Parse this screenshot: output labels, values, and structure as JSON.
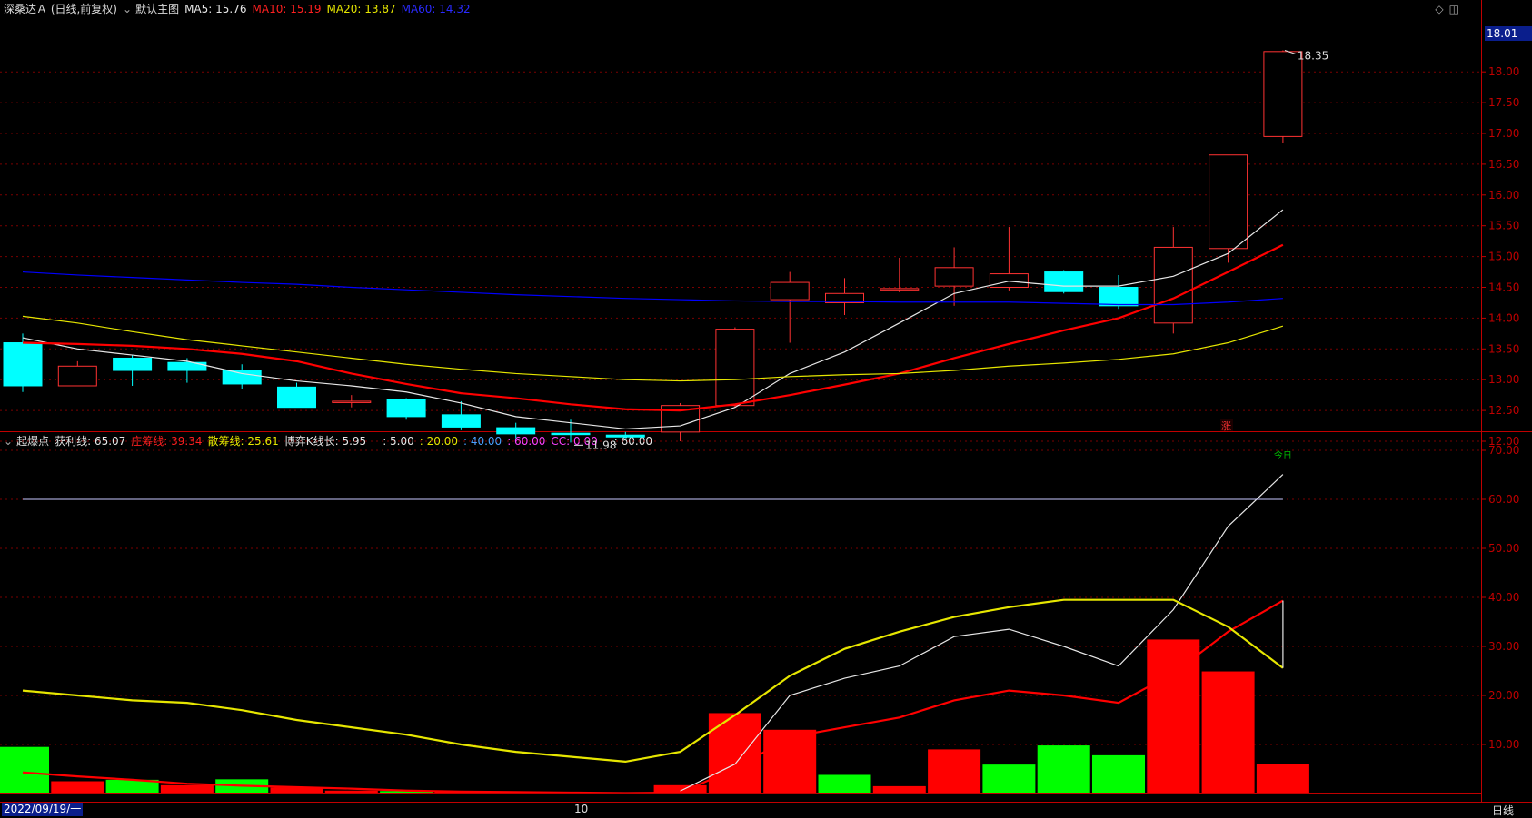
{
  "main_header": {
    "stock": "深桑达Ａ (日线,前复权)",
    "template": "默认主图",
    "ma5": "MA5: 15.76",
    "ma10": "MA10: 15.19",
    "ma20": "MA20: 13.87",
    "ma60": "MA60: 14.32"
  },
  "sub_header": {
    "name": "起爆点",
    "huoli": "获利线: 65.07",
    "zhuang": "庄筹线: 39.34",
    "san": "散筹线: 25.61",
    "boyi": "博弈K线长: 5.95",
    "v1": ": 5.00",
    "v2": ": 20.00",
    "v3": ": 40.00",
    "v4": ": 60.00",
    "cc": "CC: 0.00",
    "v5": ": 60.00"
  },
  "colors": {
    "up": "#ff3232",
    "down": "#00ffff",
    "ma5": "#e6e6e6",
    "ma10": "#ff0000",
    "ma20": "#e6e600",
    "ma60": "#0000ff",
    "grid": "#7a0000",
    "bar_red": "#ff0000",
    "bar_green": "#00ff00"
  },
  "price_tag": "18.01",
  "max_label": "18.35",
  "min_label": "11.98",
  "zhang_marker": "涨",
  "signal_label": "今日",
  "date_left": "2022/09/19/一",
  "date_mid": "10",
  "period_label": "日线",
  "window_icons": [
    "diamond-icon",
    "restore-icon"
  ],
  "chart_data": [
    {
      "type": "candlestick",
      "title": "深桑达Ａ (日线,前复权)",
      "ylim": [
        11.85,
        18.15
      ],
      "yticks": [
        12.0,
        12.5,
        13.0,
        13.5,
        14.0,
        14.5,
        15.0,
        15.5,
        16.0,
        16.5,
        17.0,
        17.5,
        18.0
      ],
      "candles": [
        {
          "o": 13.6,
          "h": 13.75,
          "l": 12.8,
          "c": 12.9
        },
        {
          "o": 12.9,
          "h": 13.3,
          "l": 12.9,
          "c": 13.22
        },
        {
          "o": 13.35,
          "h": 13.4,
          "l": 12.9,
          "c": 13.15
        },
        {
          "o": 13.28,
          "h": 13.35,
          "l": 12.95,
          "c": 13.15
        },
        {
          "o": 13.15,
          "h": 13.25,
          "l": 12.85,
          "c": 12.93
        },
        {
          "o": 12.88,
          "h": 12.95,
          "l": 12.55,
          "c": 12.55
        },
        {
          "o": 12.65,
          "h": 12.75,
          "l": 12.55,
          "c": 12.65
        },
        {
          "o": 12.68,
          "h": 12.7,
          "l": 12.35,
          "c": 12.4
        },
        {
          "o": 12.43,
          "h": 12.65,
          "l": 12.18,
          "c": 12.23
        },
        {
          "o": 12.22,
          "h": 12.3,
          "l": 12.05,
          "c": 12.12
        },
        {
          "o": 12.13,
          "h": 12.35,
          "l": 11.98,
          "c": 12.12
        },
        {
          "o": 12.1,
          "h": 12.15,
          "l": 12.05,
          "c": 12.07
        },
        {
          "o": 12.15,
          "h": 12.62,
          "l": 12.0,
          "c": 12.58
        },
        {
          "o": 12.58,
          "h": 13.85,
          "l": 12.55,
          "c": 13.82
        },
        {
          "o": 14.3,
          "h": 14.75,
          "l": 13.6,
          "c": 14.58
        },
        {
          "o": 14.25,
          "h": 14.65,
          "l": 14.05,
          "c": 14.4
        },
        {
          "o": 14.48,
          "h": 14.98,
          "l": 14.42,
          "c": 14.48
        },
        {
          "o": 14.52,
          "h": 15.15,
          "l": 14.2,
          "c": 14.82
        },
        {
          "o": 14.5,
          "h": 15.48,
          "l": 14.45,
          "c": 14.72
        },
        {
          "o": 14.75,
          "h": 14.78,
          "l": 14.4,
          "c": 14.43
        },
        {
          "o": 14.5,
          "h": 14.7,
          "l": 14.15,
          "c": 14.2
        },
        {
          "o": 13.92,
          "h": 15.48,
          "l": 13.75,
          "c": 15.15
        },
        {
          "o": 15.13,
          "h": 16.65,
          "l": 14.9,
          "c": 16.65
        },
        {
          "o": 16.95,
          "h": 18.35,
          "l": 16.85,
          "c": 18.33
        }
      ],
      "series": [
        {
          "name": "MA5",
          "values": [
            13.68,
            13.5,
            13.4,
            13.3,
            13.1,
            12.98,
            12.9,
            12.8,
            12.62,
            12.4,
            12.3,
            12.2,
            12.25,
            12.55,
            13.1,
            13.45,
            13.92,
            14.4,
            14.6,
            14.52,
            14.52,
            14.68,
            15.05,
            15.76
          ]
        },
        {
          "name": "MA10",
          "values": [
            13.6,
            13.58,
            13.55,
            13.5,
            13.42,
            13.3,
            13.1,
            12.93,
            12.78,
            12.7,
            12.6,
            12.52,
            12.5,
            12.6,
            12.75,
            12.92,
            13.1,
            13.35,
            13.58,
            13.8,
            14.0,
            14.32,
            14.75,
            15.19
          ]
        },
        {
          "name": "MA20",
          "values": [
            14.03,
            13.92,
            13.78,
            13.65,
            13.55,
            13.45,
            13.35,
            13.25,
            13.17,
            13.1,
            13.05,
            13.0,
            12.98,
            13.0,
            13.05,
            13.08,
            13.1,
            13.15,
            13.22,
            13.27,
            13.33,
            13.42,
            13.6,
            13.87
          ]
        },
        {
          "name": "MA60",
          "values": [
            14.75,
            14.7,
            14.66,
            14.62,
            14.58,
            14.55,
            14.5,
            14.46,
            14.42,
            14.38,
            14.35,
            14.32,
            14.3,
            14.28,
            14.27,
            14.27,
            14.26,
            14.26,
            14.26,
            14.24,
            14.22,
            14.22,
            14.26,
            14.32
          ]
        }
      ]
    },
    {
      "type": "bar",
      "title": "起爆点",
      "ylim": [
        0,
        73
      ],
      "yticks": [
        10.0,
        20.0,
        30.0,
        40.0,
        50.0,
        60.0,
        70.0
      ],
      "bars": [
        {
          "v": 9.5,
          "color": "green"
        },
        {
          "v": 2.5,
          "color": "red"
        },
        {
          "v": 2.8,
          "color": "green"
        },
        {
          "v": 1.7,
          "color": "red"
        },
        {
          "v": 2.9,
          "color": "green"
        },
        {
          "v": 1.2,
          "color": "red"
        },
        {
          "v": 0.6,
          "color": "red"
        },
        {
          "v": 0.5,
          "color": "green"
        },
        {
          "v": 0.4,
          "color": "red"
        },
        {
          "v": 0.3,
          "color": "red"
        },
        {
          "v": 0.2,
          "color": "red"
        },
        {
          "v": 0.2,
          "color": "red"
        },
        {
          "v": 1.7,
          "color": "red"
        },
        {
          "v": 16.4,
          "color": "red"
        },
        {
          "v": 13.0,
          "color": "red"
        },
        {
          "v": 3.8,
          "color": "green"
        },
        {
          "v": 1.5,
          "color": "red"
        },
        {
          "v": 9.0,
          "color": "red"
        },
        {
          "v": 5.9,
          "color": "green"
        },
        {
          "v": 9.8,
          "color": "green"
        },
        {
          "v": 7.8,
          "color": "green"
        },
        {
          "v": 31.4,
          "color": "red"
        },
        {
          "v": 24.9,
          "color": "red"
        },
        {
          "v": 5.95,
          "color": "red"
        }
      ],
      "series": [
        {
          "name": "获利线",
          "values": [
            null,
            null,
            null,
            null,
            null,
            null,
            null,
            null,
            null,
            null,
            null,
            null,
            0.5,
            6.0,
            20.0,
            23.5,
            26.0,
            32.0,
            33.5,
            30.0,
            26.0,
            37.5,
            54.5,
            65.07
          ]
        },
        {
          "name": "庄筹线",
          "values": [
            4.3,
            3.5,
            2.8,
            2.0,
            1.6,
            1.3,
            1.0,
            0.6,
            0.4,
            0.3,
            0.2,
            0.1,
            0.2,
            5.0,
            11.5,
            13.5,
            15.5,
            19.0,
            21.0,
            20.0,
            18.5,
            24.5,
            33.0,
            39.34
          ]
        },
        {
          "name": "散筹线",
          "values": [
            21.0,
            20.0,
            19.0,
            18.5,
            17.0,
            15.0,
            13.5,
            12.0,
            10.0,
            8.5,
            7.5,
            6.5,
            8.5,
            16.0,
            24.0,
            29.5,
            33.0,
            36.0,
            38.0,
            39.5,
            39.5,
            39.5,
            34.0,
            25.61
          ]
        },
        {
          "name": "60",
          "values": [
            60,
            60,
            60,
            60,
            60,
            60,
            60,
            60,
            60,
            60,
            60,
            60,
            60,
            60,
            60,
            60,
            60,
            60,
            60,
            60,
            60,
            60,
            60,
            60
          ]
        }
      ]
    }
  ]
}
